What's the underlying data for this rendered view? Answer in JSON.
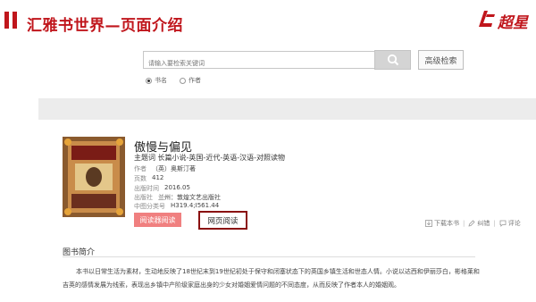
{
  "header": {
    "title": "汇雅书世界—页面介绍",
    "accent_color": "#c0161c",
    "logo_text": "超星"
  },
  "search": {
    "placeholder": "请输入要检索关键词",
    "button_icon": "search-icon",
    "advanced_label": "高级检索",
    "options": [
      {
        "label": "书名",
        "selected": true
      },
      {
        "label": "作者",
        "selected": false
      }
    ]
  },
  "book": {
    "title": "傲慢与偏见",
    "topic_label": "主题词",
    "topic_value": "长篇小说-英国-近代-英语-汉语-对照读物",
    "author_label": "作者",
    "author_value": "（英）奥斯汀著",
    "pages_label": "页数",
    "pages_value": "412",
    "date_label": "出版时间",
    "date_value": "2016.05",
    "publisher_label": "出版社",
    "publisher_value": "兰州：敦煌文艺出版社",
    "class_label": "中图分类号",
    "class_value": "H319.4;I561.44",
    "reader_button": "阅读器阅读",
    "web_button": "网页阅读"
  },
  "actions": {
    "download": "下载本书",
    "correct": "纠错",
    "comment": "评论"
  },
  "intro": {
    "heading": "图书简介",
    "text": "本书以日常生活为素材，生动地反映了18世纪末到19世纪初处于保守和闭塞状态下的英国乡镇生活和世态人情。小说以达西和伊丽莎白，彬格莱和吉英的感情发展为线索，表现出乡镇中产阶级家庭出身的少女对婚姻爱情问题的不同态度，从而反映了作者本人的婚姻观。"
  }
}
